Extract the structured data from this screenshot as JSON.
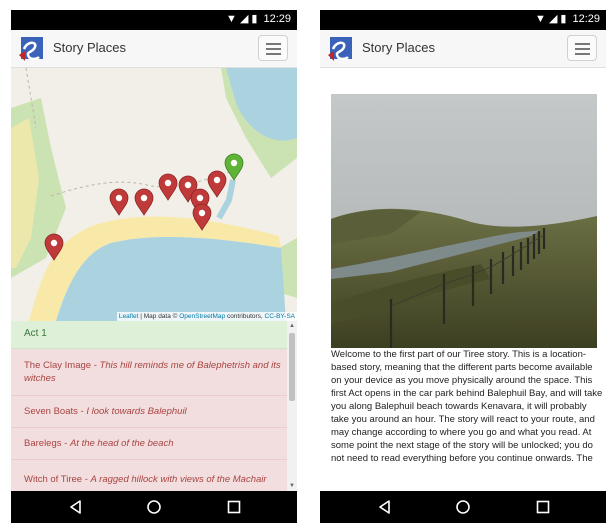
{
  "status_bar": {
    "time": "12:29",
    "icons": [
      "wifi-icon",
      "signal-icon",
      "battery-icon"
    ]
  },
  "app": {
    "title": "Story Places"
  },
  "map": {
    "attribution": {
      "leaflet": "Leaflet",
      "separator": " | Map data © ",
      "osm": "OpenStreetMap",
      "contributors": " contributors, ",
      "license": "CC-BY-SA"
    },
    "markers": [
      {
        "name": "marker-red-1",
        "color": "#c03a3a"
      },
      {
        "name": "marker-red-2",
        "color": "#c03a3a"
      },
      {
        "name": "marker-red-3",
        "color": "#c03a3a"
      },
      {
        "name": "marker-red-4",
        "color": "#c03a3a"
      },
      {
        "name": "marker-red-5",
        "color": "#c03a3a"
      },
      {
        "name": "marker-red-6",
        "color": "#c03a3a"
      },
      {
        "name": "marker-red-7",
        "color": "#c03a3a"
      },
      {
        "name": "marker-red-8",
        "color": "#c03a3a"
      },
      {
        "name": "marker-green",
        "color": "#5fb336"
      }
    ]
  },
  "list": {
    "header": "Act 1",
    "items": [
      {
        "title": "The Clay Image",
        "sep": " - ",
        "desc": "This hill reminds me of Balephetrish and its witches"
      },
      {
        "title": "Seven Boats",
        "sep": " - ",
        "desc": "I look towards Balephuil"
      },
      {
        "title": "Barelegs",
        "sep": " - ",
        "desc": "At the head of the beach"
      },
      {
        "title": "Witch of Tiree",
        "sep": " - ",
        "desc": "A ragged hillock with views of the Machair"
      }
    ]
  },
  "story": {
    "intro": "Welcome to the first part of our Tiree story. This is a location-based story, meaning that the different parts become available on your device as you move physically around the space. This first Act opens in the car park behind Balephuil Bay, and will take you along Balephuil beach towards Kenavara, it will probably take you around an hour. The story will react to your route, and may change according to where you go and what you read. At some point the next stage of the story will be unlocked; you do not need to read everything before you continue onwards. The"
  },
  "nav": {
    "back": "back-icon",
    "home": "home-icon",
    "recents": "recents-icon"
  },
  "colors": {
    "list_bg": "#f2dede",
    "list_text": "#a94442",
    "header_bg": "#dff0d8",
    "header_text": "#3c763d",
    "beach": "#f9e9a8",
    "sea": "#aad3df",
    "grass": "#cbe3b2"
  }
}
